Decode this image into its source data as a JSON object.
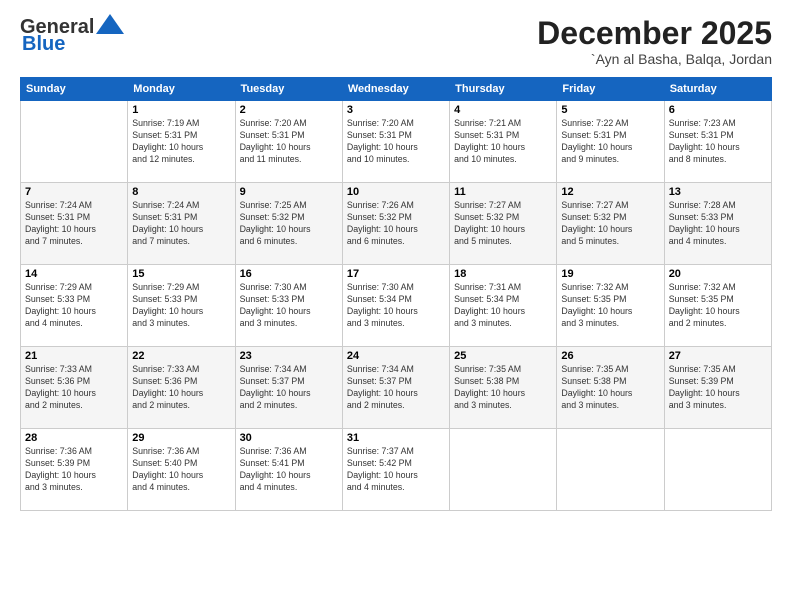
{
  "logo": {
    "line1": "General",
    "line2": "Blue"
  },
  "header": {
    "month": "December 2025",
    "location": "`Ayn al Basha, Balqa, Jordan"
  },
  "weekdays": [
    "Sunday",
    "Monday",
    "Tuesday",
    "Wednesday",
    "Thursday",
    "Friday",
    "Saturday"
  ],
  "weeks": [
    [
      {
        "day": "",
        "info": ""
      },
      {
        "day": "1",
        "info": "Sunrise: 7:19 AM\nSunset: 5:31 PM\nDaylight: 10 hours\nand 12 minutes."
      },
      {
        "day": "2",
        "info": "Sunrise: 7:20 AM\nSunset: 5:31 PM\nDaylight: 10 hours\nand 11 minutes."
      },
      {
        "day": "3",
        "info": "Sunrise: 7:20 AM\nSunset: 5:31 PM\nDaylight: 10 hours\nand 10 minutes."
      },
      {
        "day": "4",
        "info": "Sunrise: 7:21 AM\nSunset: 5:31 PM\nDaylight: 10 hours\nand 10 minutes."
      },
      {
        "day": "5",
        "info": "Sunrise: 7:22 AM\nSunset: 5:31 PM\nDaylight: 10 hours\nand 9 minutes."
      },
      {
        "day": "6",
        "info": "Sunrise: 7:23 AM\nSunset: 5:31 PM\nDaylight: 10 hours\nand 8 minutes."
      }
    ],
    [
      {
        "day": "7",
        "info": "Sunrise: 7:24 AM\nSunset: 5:31 PM\nDaylight: 10 hours\nand 7 minutes."
      },
      {
        "day": "8",
        "info": "Sunrise: 7:24 AM\nSunset: 5:31 PM\nDaylight: 10 hours\nand 7 minutes."
      },
      {
        "day": "9",
        "info": "Sunrise: 7:25 AM\nSunset: 5:32 PM\nDaylight: 10 hours\nand 6 minutes."
      },
      {
        "day": "10",
        "info": "Sunrise: 7:26 AM\nSunset: 5:32 PM\nDaylight: 10 hours\nand 6 minutes."
      },
      {
        "day": "11",
        "info": "Sunrise: 7:27 AM\nSunset: 5:32 PM\nDaylight: 10 hours\nand 5 minutes."
      },
      {
        "day": "12",
        "info": "Sunrise: 7:27 AM\nSunset: 5:32 PM\nDaylight: 10 hours\nand 5 minutes."
      },
      {
        "day": "13",
        "info": "Sunrise: 7:28 AM\nSunset: 5:33 PM\nDaylight: 10 hours\nand 4 minutes."
      }
    ],
    [
      {
        "day": "14",
        "info": "Sunrise: 7:29 AM\nSunset: 5:33 PM\nDaylight: 10 hours\nand 4 minutes."
      },
      {
        "day": "15",
        "info": "Sunrise: 7:29 AM\nSunset: 5:33 PM\nDaylight: 10 hours\nand 3 minutes."
      },
      {
        "day": "16",
        "info": "Sunrise: 7:30 AM\nSunset: 5:33 PM\nDaylight: 10 hours\nand 3 minutes."
      },
      {
        "day": "17",
        "info": "Sunrise: 7:30 AM\nSunset: 5:34 PM\nDaylight: 10 hours\nand 3 minutes."
      },
      {
        "day": "18",
        "info": "Sunrise: 7:31 AM\nSunset: 5:34 PM\nDaylight: 10 hours\nand 3 minutes."
      },
      {
        "day": "19",
        "info": "Sunrise: 7:32 AM\nSunset: 5:35 PM\nDaylight: 10 hours\nand 3 minutes."
      },
      {
        "day": "20",
        "info": "Sunrise: 7:32 AM\nSunset: 5:35 PM\nDaylight: 10 hours\nand 2 minutes."
      }
    ],
    [
      {
        "day": "21",
        "info": "Sunrise: 7:33 AM\nSunset: 5:36 PM\nDaylight: 10 hours\nand 2 minutes."
      },
      {
        "day": "22",
        "info": "Sunrise: 7:33 AM\nSunset: 5:36 PM\nDaylight: 10 hours\nand 2 minutes."
      },
      {
        "day": "23",
        "info": "Sunrise: 7:34 AM\nSunset: 5:37 PM\nDaylight: 10 hours\nand 2 minutes."
      },
      {
        "day": "24",
        "info": "Sunrise: 7:34 AM\nSunset: 5:37 PM\nDaylight: 10 hours\nand 2 minutes."
      },
      {
        "day": "25",
        "info": "Sunrise: 7:35 AM\nSunset: 5:38 PM\nDaylight: 10 hours\nand 3 minutes."
      },
      {
        "day": "26",
        "info": "Sunrise: 7:35 AM\nSunset: 5:38 PM\nDaylight: 10 hours\nand 3 minutes."
      },
      {
        "day": "27",
        "info": "Sunrise: 7:35 AM\nSunset: 5:39 PM\nDaylight: 10 hours\nand 3 minutes."
      }
    ],
    [
      {
        "day": "28",
        "info": "Sunrise: 7:36 AM\nSunset: 5:39 PM\nDaylight: 10 hours\nand 3 minutes."
      },
      {
        "day": "29",
        "info": "Sunrise: 7:36 AM\nSunset: 5:40 PM\nDaylight: 10 hours\nand 4 minutes."
      },
      {
        "day": "30",
        "info": "Sunrise: 7:36 AM\nSunset: 5:41 PM\nDaylight: 10 hours\nand 4 minutes."
      },
      {
        "day": "31",
        "info": "Sunrise: 7:37 AM\nSunset: 5:42 PM\nDaylight: 10 hours\nand 4 minutes."
      },
      {
        "day": "",
        "info": ""
      },
      {
        "day": "",
        "info": ""
      },
      {
        "day": "",
        "info": ""
      }
    ]
  ]
}
